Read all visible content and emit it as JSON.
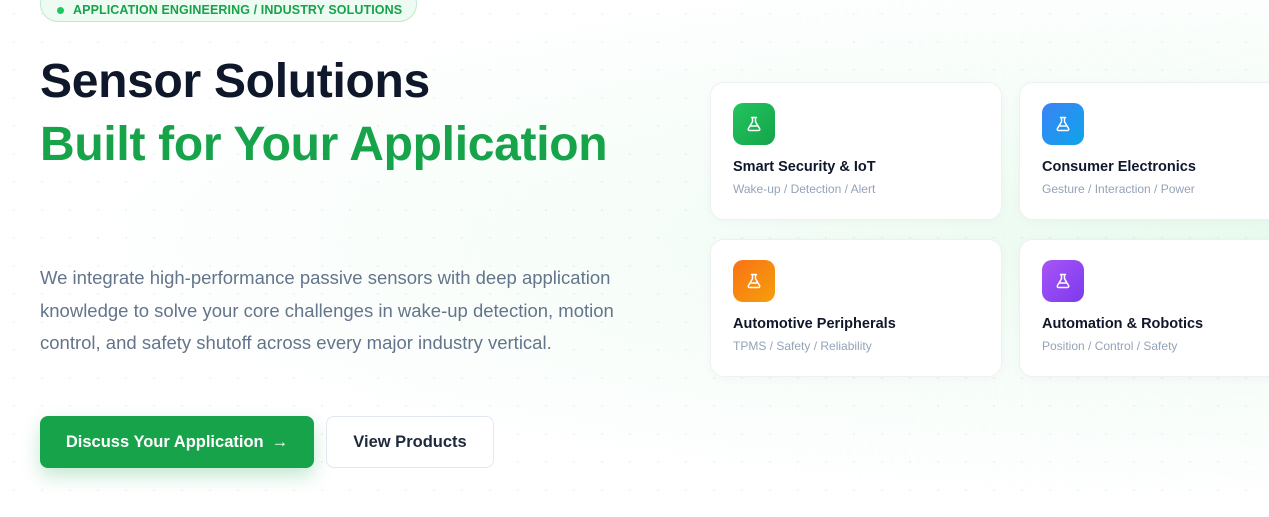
{
  "badge": {
    "label": "APPLICATION ENGINEERING / INDUSTRY SOLUTIONS"
  },
  "hero": {
    "title_line1": "Sensor Solutions",
    "title_line2": "Built for Your Application",
    "lead": "We integrate high-performance passive sensors with deep application knowledge to solve your core challenges in wake-up detection, motion control, and safety shutoff across every major industry vertical."
  },
  "buttons": {
    "primary": "Discuss Your Application",
    "primary_arrow": "→",
    "secondary": "View Products"
  },
  "cards": [
    {
      "title": "Smart Security & IoT",
      "subtitle": "Wake-up / Detection / Alert",
      "icon": "flask-icon",
      "color": "#16a34a"
    },
    {
      "title": "Consumer Electronics",
      "subtitle": "Gesture / Interaction / Power",
      "icon": "flask-icon",
      "color": "#2563eb"
    },
    {
      "title": "Automotive Peripherals",
      "subtitle": "TPMS / Safety / Reliability",
      "icon": "flask-icon",
      "color": "#f97316"
    },
    {
      "title": "Automation & Robotics",
      "subtitle": "Position / Control / Safety",
      "icon": "flask-icon",
      "color": "#9333ea"
    }
  ],
  "colors": {
    "accent": "#16a34a",
    "heading": "#0f172a",
    "body_text": "#64748b"
  }
}
